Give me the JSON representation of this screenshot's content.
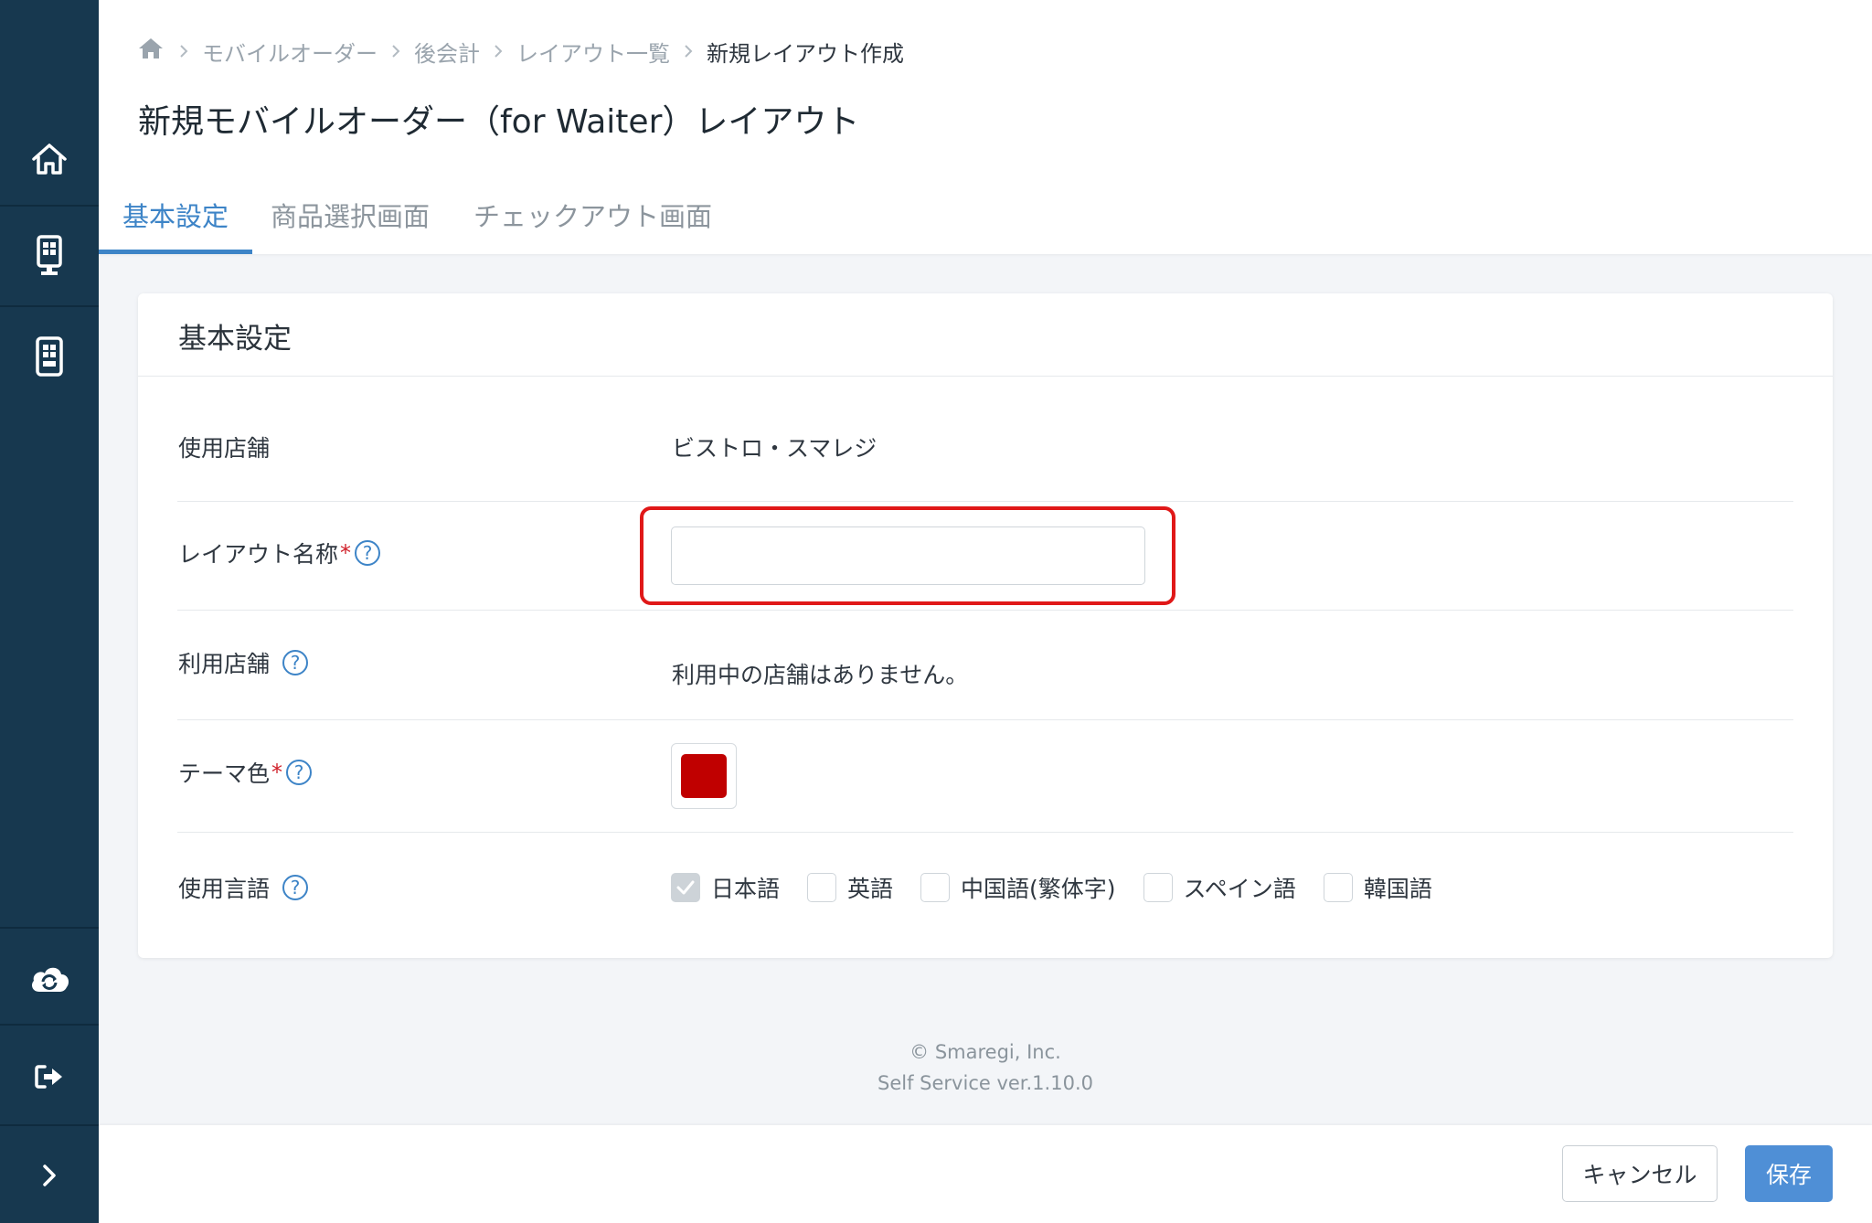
{
  "sidebar": {
    "items": [
      {
        "icon": "home-icon"
      },
      {
        "icon": "kiosk-icon"
      },
      {
        "icon": "tablet-icon"
      },
      {
        "icon": "cloud-sync-icon"
      },
      {
        "icon": "logout-icon"
      },
      {
        "icon": "chevron-right-icon"
      }
    ]
  },
  "breadcrumb": {
    "items": [
      "モバイルオーダー",
      "後会計",
      "レイアウト一覧"
    ],
    "current": "新規レイアウト作成"
  },
  "page": {
    "title": "新規モバイルオーダー（for Waiter）レイアウト"
  },
  "tabs": [
    "基本設定",
    "商品選択画面",
    "チェックアウト画面"
  ],
  "card": {
    "title": "基本設定",
    "rows": {
      "store": {
        "label": "使用店舗",
        "value": "ビストロ・スマレジ"
      },
      "layout_name": {
        "label": "レイアウト名称",
        "required": "*",
        "help": "?",
        "value": "",
        "placeholder": ""
      },
      "used_stores": {
        "label": "利用店舗",
        "help": "?",
        "value": "利用中の店舗はありません。"
      },
      "theme_color": {
        "label": "テーマ色",
        "required": "*",
        "help": "?",
        "color": "#c00000"
      },
      "languages": {
        "label": "使用言語",
        "help": "?",
        "options": [
          {
            "label": "日本語",
            "checked": true
          },
          {
            "label": "英語",
            "checked": false
          },
          {
            "label": "中国語(繁体字)",
            "checked": false
          },
          {
            "label": "スペイン語",
            "checked": false
          },
          {
            "label": "韓国語",
            "checked": false
          }
        ]
      }
    }
  },
  "footer": {
    "copyright": "© Smaregi, Inc.",
    "version": "Self Service ver.1.10.0"
  },
  "actions": {
    "cancel_label": "キャンセル",
    "save_label": "保存"
  },
  "colors": {
    "sidebar": "#17384f",
    "accent": "#3d84c7",
    "save": "#4f8fd6",
    "highlight": "#e01818"
  }
}
